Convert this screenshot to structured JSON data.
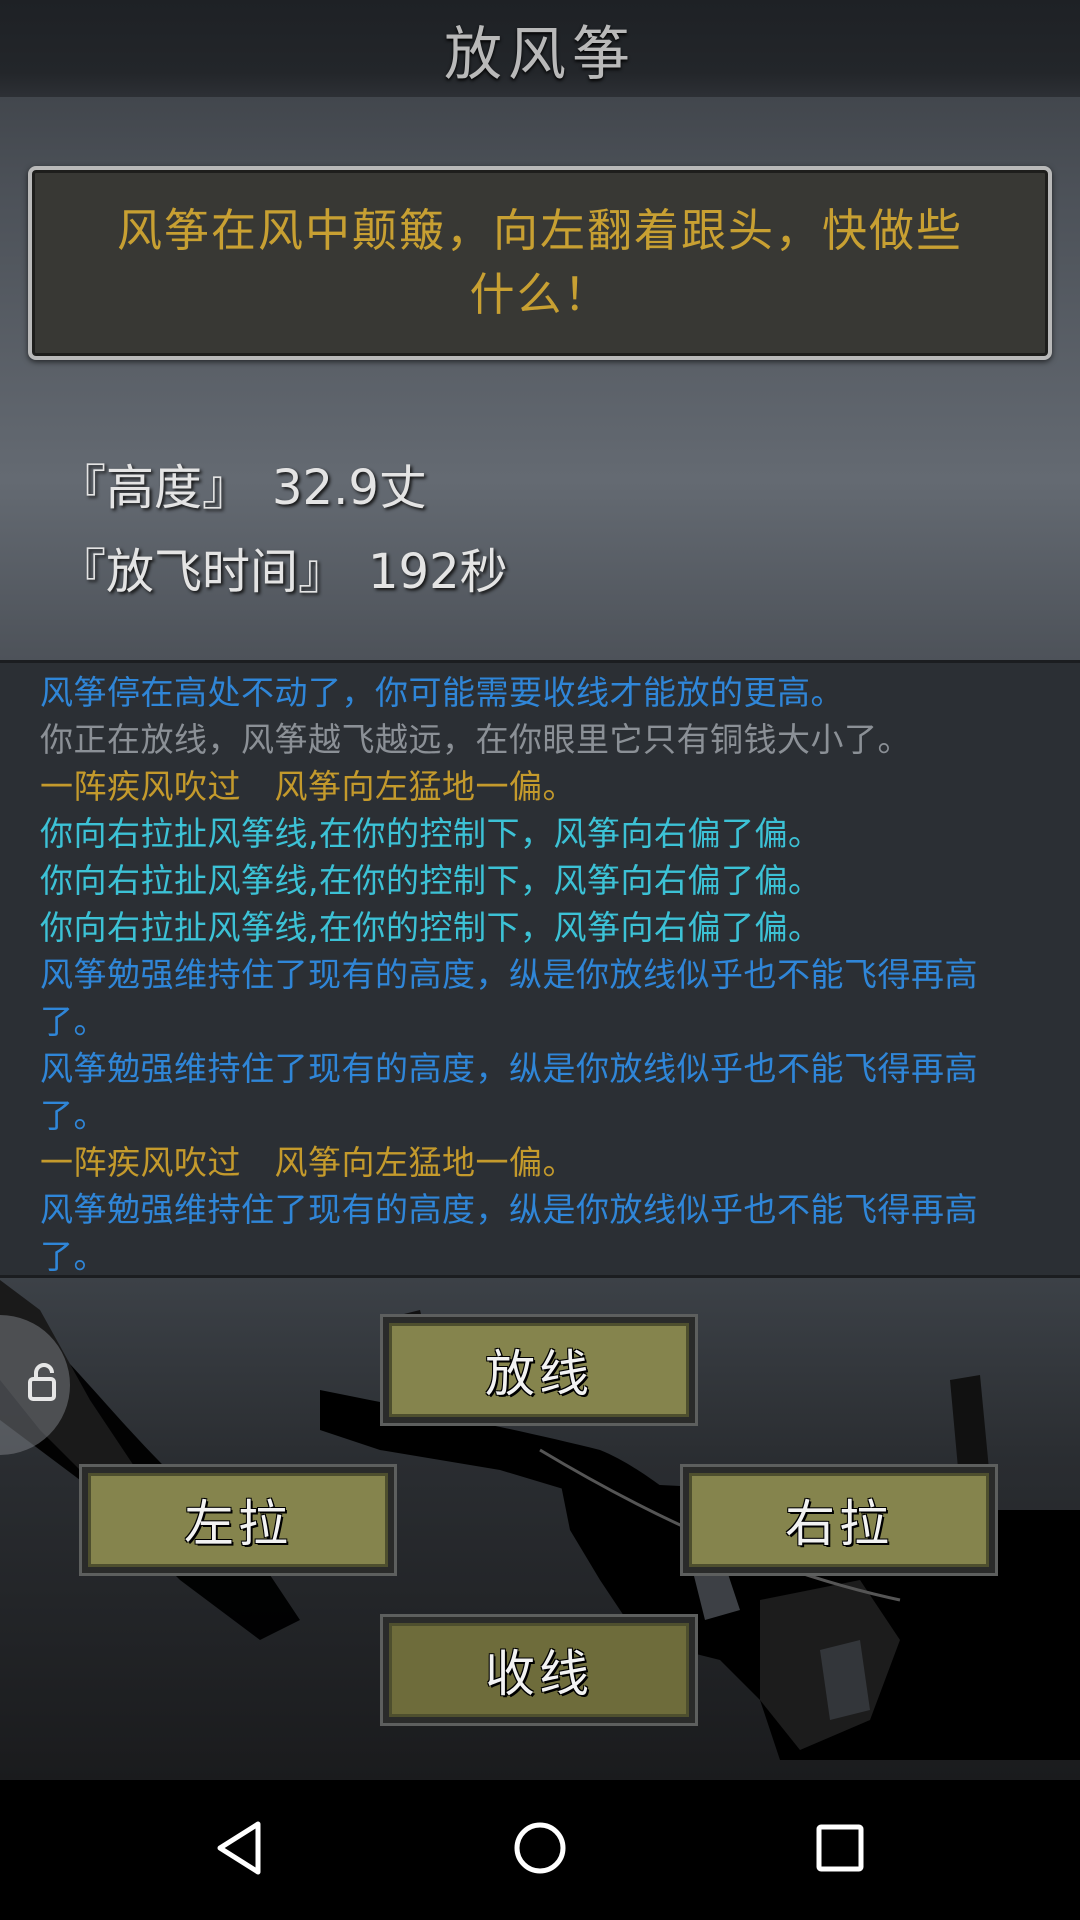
{
  "app": {
    "title": "放风筝"
  },
  "event": {
    "message": "风筝在风中颠簸，向左翻着跟头，快做些什么！"
  },
  "stats": {
    "height_label": "『高度』",
    "height_value": "32.9丈",
    "time_label": "『放飞时间』",
    "time_value": "192秒"
  },
  "log": [
    {
      "text": "风筝停在高处不动了，你可能需要收线才能放的更高。",
      "color": "#2f86d8"
    },
    {
      "text": "你正在放线，风筝越飞越远，在你眼里它只有铜钱大小了。",
      "color": "#8b9096"
    },
    {
      "text": "一阵疾风吹过　风筝向左猛地一偏。",
      "color": "#c49a2c"
    },
    {
      "text": "你向右拉扯风筝线,在你的控制下，风筝向右偏了偏。",
      "color": "#3cc2d6"
    },
    {
      "text": "你向右拉扯风筝线,在你的控制下，风筝向右偏了偏。",
      "color": "#3cc2d6"
    },
    {
      "text": "你向右拉扯风筝线,在你的控制下，风筝向右偏了偏。",
      "color": "#3cc2d6"
    },
    {
      "text": "风筝勉强维持住了现有的高度，纵是你放线似乎也不能飞得再高了。",
      "color": "#2f86d8"
    },
    {
      "text": "风筝勉强维持住了现有的高度，纵是你放线似乎也不能飞得再高了。",
      "color": "#2f86d8"
    },
    {
      "text": "一阵疾风吹过　风筝向左猛地一偏。",
      "color": "#c49a2c"
    },
    {
      "text": "风筝勉强维持住了现有的高度，纵是你放线似乎也不能飞得再高了。",
      "color": "#2f86d8"
    }
  ],
  "controls": {
    "release": "放线",
    "pull_left": "左拉",
    "pull_right": "右拉",
    "reel_in": "收线"
  },
  "floating": {
    "icon": "lock-icon"
  },
  "nav": {
    "back_icon": "back-icon",
    "home_icon": "home-icon",
    "recents_icon": "recents-icon"
  }
}
